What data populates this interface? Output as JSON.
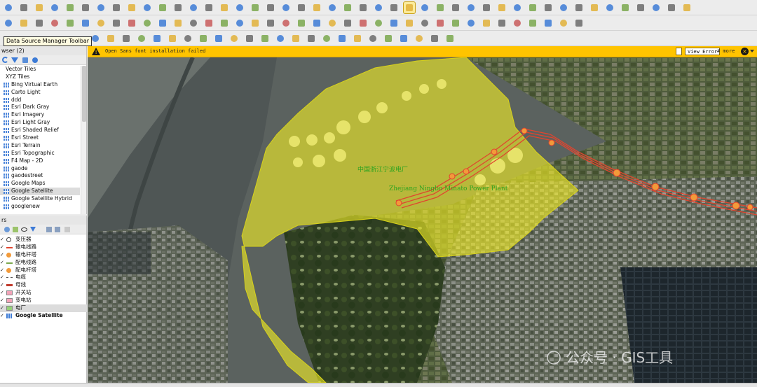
{
  "tooltip": {
    "text": "Data Source Manager Toolbar"
  },
  "browser": {
    "title": "wser (2)",
    "items": [
      {
        "label": "Vector Tiles",
        "type": "folder"
      },
      {
        "label": "XYZ Tiles",
        "type": "folder"
      },
      {
        "label": "Bing Virtual Earth"
      },
      {
        "label": "Carto Light"
      },
      {
        "label": "ddd"
      },
      {
        "label": "Esri Dark Gray"
      },
      {
        "label": "Esri Imagery"
      },
      {
        "label": "Esri Light Gray"
      },
      {
        "label": "Esri Shaded Relief"
      },
      {
        "label": "Esri Street"
      },
      {
        "label": "Esri Terrain"
      },
      {
        "label": "Esri Topographic"
      },
      {
        "label": "F4 Map - 2D"
      },
      {
        "label": "gaode"
      },
      {
        "label": "gaodestreet"
      },
      {
        "label": "Google Maps"
      },
      {
        "label": "Google Satellite",
        "selected": true
      },
      {
        "label": "Google Satellite Hybrid"
      },
      {
        "label": "googlenew"
      }
    ]
  },
  "layers": {
    "title": "rs",
    "items": [
      {
        "label": "变压器",
        "symbol": "circle-outline",
        "color": "#444444"
      },
      {
        "label": "输电线路",
        "symbol": "line",
        "color": "#e0452f"
      },
      {
        "label": "输电杆塔",
        "symbol": "circle",
        "color": "#f29a3a"
      },
      {
        "label": "配电线路",
        "symbol": "line",
        "color": "#7aa84e"
      },
      {
        "label": "配电杆塔",
        "symbol": "circle",
        "color": "#f29a3a"
      },
      {
        "label": "电缆",
        "symbol": "dash",
        "color": "#555555"
      },
      {
        "label": "母线",
        "symbol": "line-thick",
        "color": "#c0392b"
      },
      {
        "label": "开关站",
        "symbol": "fill",
        "color": "#f3a3b8"
      },
      {
        "label": "变电站",
        "symbol": "fill",
        "color": "#f3a3b8"
      },
      {
        "label": "电厂",
        "symbol": "fill",
        "color": "#96d17a",
        "selected": true
      },
      {
        "label": "Google Satellite",
        "symbol": "raster",
        "color": "#3d7bd6",
        "bold": true
      }
    ]
  },
  "message_bar": {
    "text": "Open Sans font installation failed",
    "view_error": "View Error",
    "more": "# more",
    "color": "#ffc400"
  },
  "map": {
    "plant_label_cn": "中国浙江宁波电厂",
    "plant_label_en": "Zhejiang Ningbo Minato Power Plant",
    "watermark": "公众号 · GIS工具",
    "highlight_color": "#f2ee25",
    "line_color": "#e0452f"
  }
}
